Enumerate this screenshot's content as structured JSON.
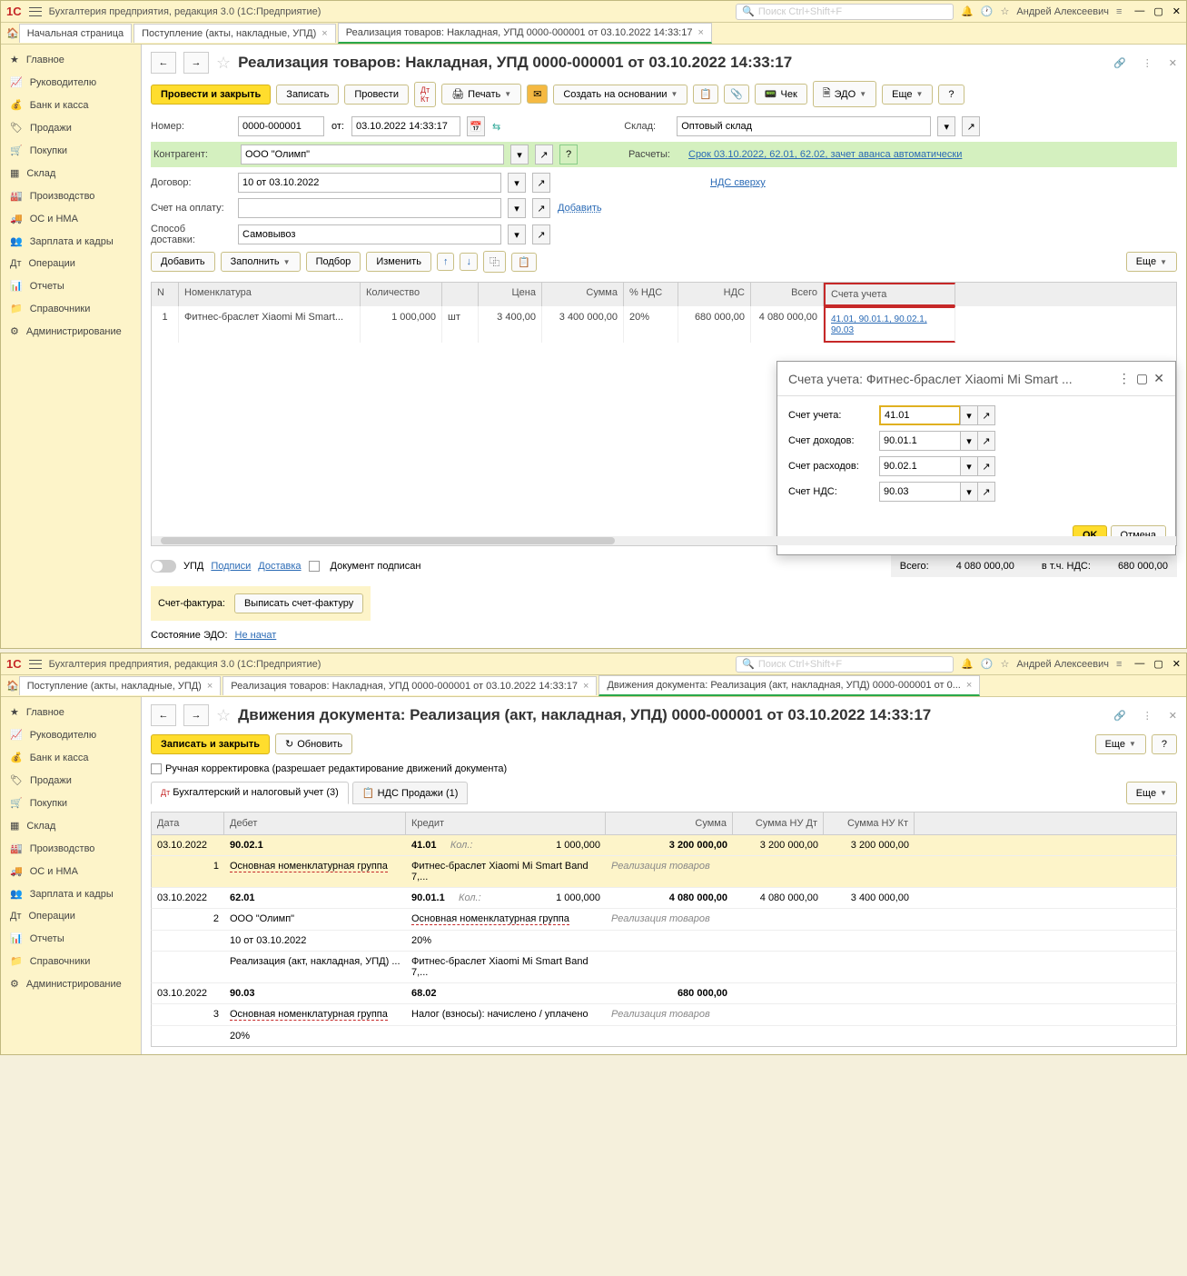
{
  "titlebar": {
    "title": "Бухгалтерия предприятия, редакция 3.0  (1С:Предприятие)",
    "search_placeholder": "Поиск Ctrl+Shift+F",
    "user": "Андрей Алексеевич"
  },
  "tabs_top1": {
    "home": "Начальная страница",
    "t1": "Поступление (акты, накладные, УПД)",
    "t2": "Реализация товаров: Накладная, УПД 0000-000001 от 03.10.2022 14:33:17"
  },
  "sidebar": [
    "Главное",
    "Руководителю",
    "Банк и касса",
    "Продажи",
    "Покупки",
    "Склад",
    "Производство",
    "ОС и НМА",
    "Зарплата и кадры",
    "Операции",
    "Отчеты",
    "Справочники",
    "Администрирование"
  ],
  "main1": {
    "title": "Реализация товаров: Накладная, УПД 0000-000001 от 03.10.2022 14:33:17",
    "toolbar": {
      "post_close": "Провести и закрыть",
      "record": "Записать",
      "post": "Провести",
      "print": "Печать",
      "create_based": "Создать на основании",
      "check": "Чек",
      "edo": "ЭДО",
      "more": "Еще",
      "help": "?"
    },
    "form": {
      "num_label": "Номер:",
      "num": "0000-000001",
      "from": "от:",
      "date": "03.10.2022 14:33:17",
      "sklad_label": "Склад:",
      "sklad": "Оптовый склад",
      "contr_label": "Контрагент:",
      "contr": "ООО \"Олимп\"",
      "contr_help": "?",
      "calc_label": "Расчеты:",
      "calc_link": "Срок 03.10.2022, 62.01, 62.02, зачет аванса автоматически",
      "dog_label": "Договор:",
      "dog": "10 от 03.10.2022",
      "nds_link": "НДС сверху",
      "acc_label": "Счет на оплату:",
      "acc_add": "Добавить",
      "deliv_label": "Способ доставки:",
      "deliv": "Самовывоз"
    },
    "tbar2": {
      "add": "Добавить",
      "fill": "Заполнить",
      "select": "Подбор",
      "change": "Изменить",
      "more": "Еще"
    },
    "grid_head": [
      "N",
      "Номенклатура",
      "Количество",
      "",
      "Цена",
      "Сумма",
      "% НДС",
      "НДС",
      "Всего",
      "Счета учета"
    ],
    "grid_row": {
      "n": "1",
      "nom": "Фитнес-браслет Xiaomi Mi Smart...",
      "qty": "1 000,000",
      "unit": "шт",
      "price": "3 400,00",
      "sum": "3 400 000,00",
      "nds_pct": "20%",
      "nds": "680 000,00",
      "total": "4 080 000,00",
      "acc": "41.01, 90.01.1, 90.02.1, 90.03"
    },
    "totals": {
      "upd": "УПД",
      "signs": "Подписи",
      "delivery": "Доставка",
      "signed": "Документ подписан",
      "total_label": "Всего:",
      "total": "4 080 000,00",
      "nds_label": "в т.ч. НДС:",
      "nds": "680 000,00"
    },
    "invoice": {
      "label": "Счет-фактура:",
      "btn": "Выписать счет-фактуру"
    },
    "edo_state": {
      "label": "Состояние ЭДО:",
      "link": "Не начат"
    }
  },
  "popup": {
    "title": "Счета учета: Фитнес-браслет Xiaomi Mi Smart ...",
    "rows": [
      {
        "label": "Счет учета:",
        "val": "41.01"
      },
      {
        "label": "Счет доходов:",
        "val": "90.01.1"
      },
      {
        "label": "Счет расходов:",
        "val": "90.02.1"
      },
      {
        "label": "Счет НДС:",
        "val": "90.03"
      }
    ],
    "ok": "OK",
    "cancel": "Отмена"
  },
  "tabs_top2": {
    "home": "Начальная страница",
    "t1": "Поступление (акты, накладные, УПД)",
    "t2": "Реализация товаров: Накладная, УПД 0000-000001 от 03.10.2022 14:33:17",
    "t3": "Движения документа: Реализация (акт, накладная, УПД) 0000-000001 от 0..."
  },
  "main2": {
    "title": "Движения документа: Реализация (акт, накладная, УПД) 0000-000001 от 03.10.2022 14:33:17",
    "toolbar": {
      "write_close": "Записать и закрыть",
      "refresh": "Обновить",
      "more": "Еще",
      "help": "?"
    },
    "manual": "Ручная корректировка (разрешает редактирование движений документа)",
    "tabs": {
      "t1": "Бухгалтерский и налоговый учет (3)",
      "t2": "НДС Продажи (1)",
      "more": "Еще"
    },
    "grid_head": [
      "Дата",
      "Дебет",
      "Кредит",
      "Сумма",
      "Сумма НУ Дт",
      "Сумма НУ Кт"
    ],
    "r1": {
      "date": "03.10.2022",
      "n": "1",
      "dt": "90.02.1",
      "kt": "41.01",
      "kol": "Кол.:",
      "qty": "1 000,000",
      "sum": "3 200 000,00",
      "nudt": "3 200 000,00",
      "nukt": "3 200 000,00",
      "dt2": "Основная номенклатурная группа",
      "kt2": "Фитнес-браслет Xiaomi Mi Smart Band 7,...",
      "desc": "Реализация товаров"
    },
    "r2": {
      "date": "03.10.2022",
      "n": "2",
      "dt": "62.01",
      "kt": "90.01.1",
      "kol": "Кол.:",
      "qty": "1 000,000",
      "sum": "4 080 000,00",
      "nudt": "4 080 000,00",
      "nukt": "3 400 000,00",
      "dt2": "ООО \"Олимп\"",
      "dt3": "10 от 03.10.2022",
      "dt4": "Реализация (акт, накладная, УПД) ...",
      "kt2": "Основная номенклатурная группа",
      "kt3": "20%",
      "kt4": "Фитнес-браслет Xiaomi Mi Smart Band 7,...",
      "desc": "Реализация товаров"
    },
    "r3": {
      "date": "03.10.2022",
      "n": "3",
      "dt": "90.03",
      "kt": "68.02",
      "sum": "680 000,00",
      "dt2": "Основная номенклатурная группа",
      "dt3": "20%",
      "kt2": "Налог (взносы): начислено / уплачено",
      "desc": "Реализация товаров"
    }
  }
}
